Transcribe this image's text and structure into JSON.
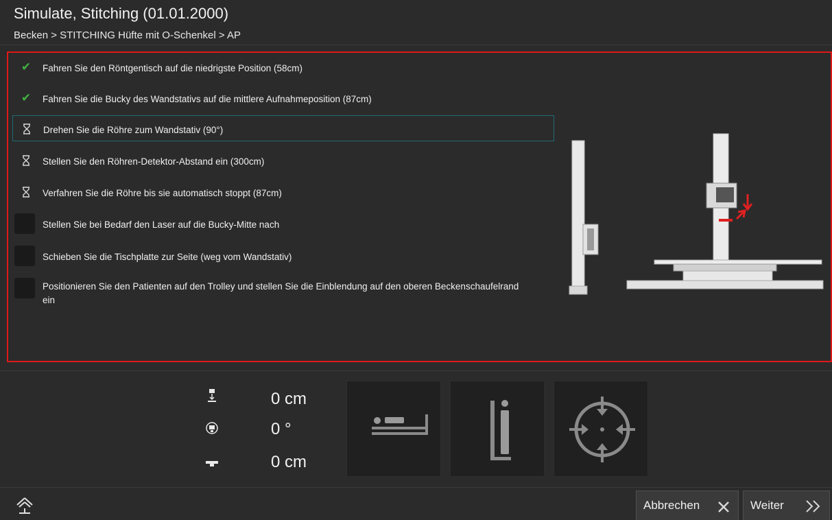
{
  "header": {
    "title": "Simulate, Stitching (01.01.2000)",
    "breadcrumb": "Becken > STITCHING Hüfte mit O-Schenkel > AP"
  },
  "steps": [
    {
      "label": "Fahren Sie den Röntgentisch auf die niedrigste Position (58cm)",
      "status": "done",
      "icon": "check-icon"
    },
    {
      "label": "Fahren Sie die Bucky des Wandstativs auf die mittlere Aufnahmeposition (87cm)",
      "status": "done",
      "icon": "check-icon"
    },
    {
      "label": "Drehen Sie die Röhre zum Wandstativ (90°)",
      "status": "pending",
      "icon": "hourglass-icon",
      "active": true
    },
    {
      "label": "Stellen Sie den Röhren-Detektor-Abstand ein (300cm)",
      "status": "pending",
      "icon": "hourglass-icon"
    },
    {
      "label": "Verfahren Sie die Röhre bis sie automatisch stoppt (87cm)",
      "status": "pending",
      "icon": "hourglass-icon"
    },
    {
      "label": "Stellen Sie bei Bedarf den Laser auf die Bucky-Mitte nach",
      "status": "manual",
      "icon": "checkbox"
    },
    {
      "label": "Schieben Sie die Tischplatte zur Seite (weg vom Wandstativ)",
      "status": "manual",
      "icon": "checkbox"
    },
    {
      "label": "Positionieren Sie den Patienten auf den Trolley und stellen Sie die Einblendung auf den oberen Beckenschaufelrand ein",
      "status": "manual",
      "icon": "checkbox"
    }
  ],
  "readouts": [
    {
      "icon": "tube-height-icon",
      "value": "0 cm"
    },
    {
      "icon": "tube-rotation-icon",
      "value": "0 °"
    },
    {
      "icon": "table-height-icon",
      "value": "0 cm"
    }
  ],
  "tiles": [
    {
      "icon": "patient-lying-icon"
    },
    {
      "icon": "patient-standing-icon"
    },
    {
      "icon": "crosshair-center-icon"
    }
  ],
  "footer": {
    "cancel_label": "Abbrechen",
    "next_label": "Weiter"
  },
  "colors": {
    "background": "#2b2b2b",
    "highlight_border": "#e01818",
    "active_step_border": "#1f6b72",
    "check_green": "#3fb03f",
    "arrow_red": "#e02020"
  }
}
